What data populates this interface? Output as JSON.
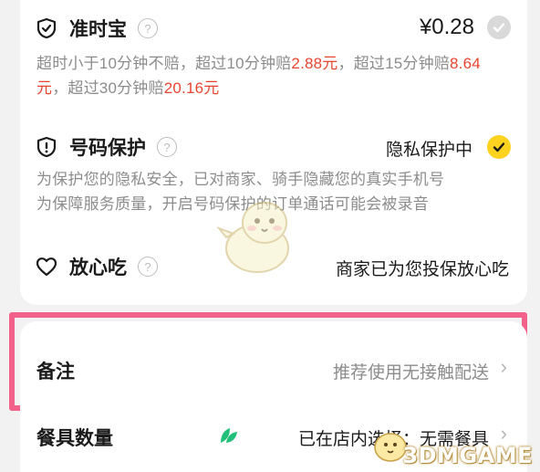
{
  "ontime": {
    "title": "准时宝",
    "help_icon": "?",
    "price": "¥0.28",
    "desc_parts": [
      "超时小于10分钟不赔，超过10分钟赔",
      "2.88元",
      "，超过15分钟赔",
      "8.64元",
      "，超过30分钟赔",
      "20.16元"
    ]
  },
  "privacy": {
    "title": "号码保护",
    "help_icon": "?",
    "status": "隐私保护中",
    "desc_lines": [
      "为保护您的隐私安全，已对商家、骑手隐藏您的真实手机号",
      "为保障服务质量，开启号码保护的订单通话可能会被录音"
    ]
  },
  "safe_eat": {
    "title": "放心吃",
    "help_icon": "?",
    "status": "商家已为您投保放心吃"
  },
  "note": {
    "label": "备注",
    "value": "推荐使用无接触配送",
    "chevron": "›"
  },
  "tableware": {
    "label": "餐具数量",
    "value": "已在店内选择：无需餐具",
    "chevron": "›"
  },
  "watermark": "3DMGAME",
  "colors": {
    "highlight": "#f2618a",
    "money_red": "#e8452f",
    "check_yellow": "#ffd21f",
    "leaf_green": "#21c07a"
  }
}
